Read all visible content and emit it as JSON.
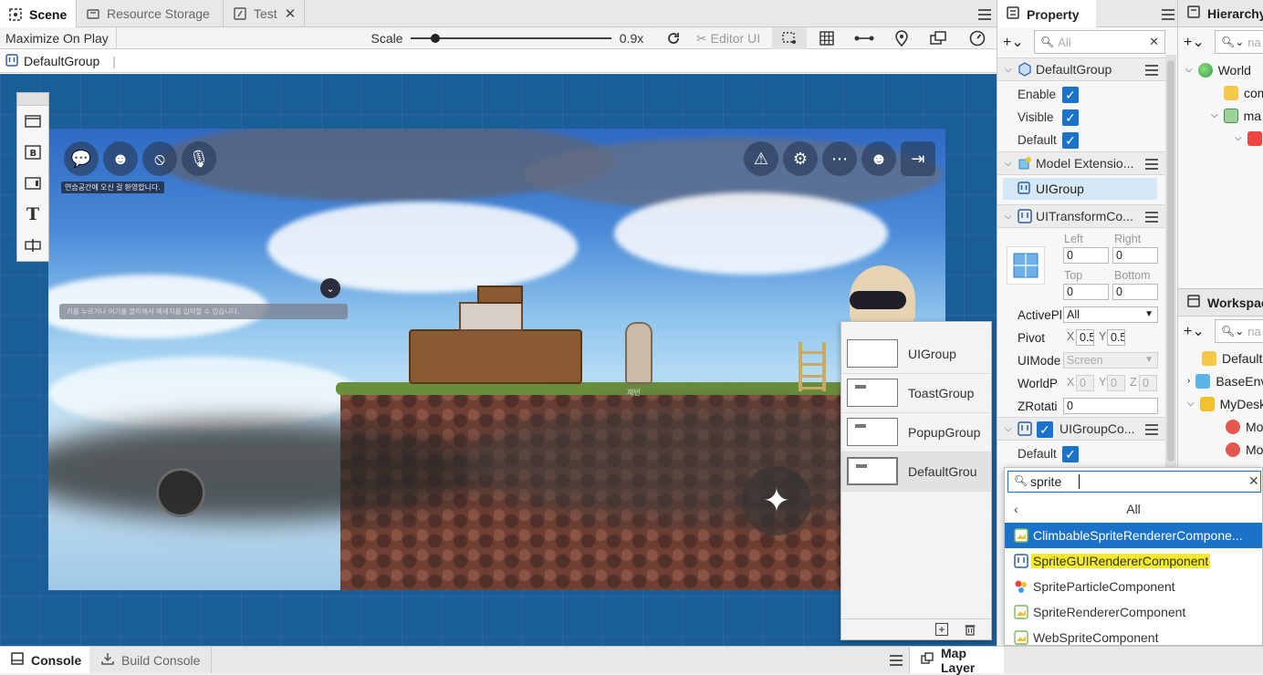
{
  "tabs": [
    {
      "label": "Scene",
      "icon": "scene-icon",
      "active": true
    },
    {
      "label": "Resource Storage",
      "icon": "storage-icon",
      "active": false
    },
    {
      "label": "Test",
      "icon": "test-icon",
      "active": false
    }
  ],
  "toolbar": {
    "maximize_label": "Maximize On Play",
    "scale_label": "Scale",
    "scale_value": "0.9x",
    "scale_fraction": 0.1,
    "editor_ui_label": "Editor UI"
  },
  "breadcrumb": {
    "label": "DefaultGroup"
  },
  "game_hud": {
    "welcome_text": "연습공간에 오신 걸 환영합니다.",
    "chat_placeholder": "키를 누르거나 여기를 클릭해서 메세지를 입력할 수 있습니다.",
    "npc_label": "재빈"
  },
  "group_popup": {
    "items": [
      {
        "label": "UIGroup",
        "selected": false
      },
      {
        "label": "ToastGroup",
        "selected": false
      },
      {
        "label": "PopupGroup",
        "selected": false
      },
      {
        "label": "DefaultGrou",
        "selected": true
      }
    ]
  },
  "property": {
    "tab_label": "Property",
    "search_placeholder": "All",
    "entity_name": "DefaultGroup",
    "enable_label": "Enable",
    "visible_label": "Visible",
    "default_label": "Default",
    "model_section": "Model Extensio...",
    "model_item": "UIGroup",
    "transform_section": "UITransformCo...",
    "left_label": "Left",
    "left_value": "0",
    "right_label": "Right",
    "right_value": "0",
    "top_label": "Top",
    "top_value": "0",
    "bottom_label": "Bottom",
    "bottom_value": "0",
    "activepl_label": "ActivePl",
    "activepl_value": "All",
    "pivot_label": "Pivot",
    "pivot_x_label": "X",
    "pivot_x": "0.5",
    "pivot_y_label": "Y",
    "pivot_y": "0.5",
    "uimode_label": "UIMode",
    "uimode_value": "Screen",
    "worldp_label": "WorldP",
    "worldp_x": "0",
    "worldp_y": "0",
    "worldp_z": "0",
    "worldp_z_label": "Z",
    "zrot_label": "ZRotati",
    "zrot_value": "0",
    "uigroup_section": "UIGroupCo...",
    "uigroup_default_label": "Default"
  },
  "component_search": {
    "query": "sprite",
    "category": "All",
    "results": [
      {
        "label": "ClimbableSpriteRendererCompone...",
        "highlighted": true,
        "icon": "sprite-component-icon"
      },
      {
        "label": "SpriteGUIRendererComponent",
        "highlighted": false,
        "marked": true,
        "icon": "ui-component-icon"
      },
      {
        "label": "SpriteParticleComponent",
        "highlighted": false,
        "icon": "particle-component-icon"
      },
      {
        "label": "SpriteRendererComponent",
        "highlighted": false,
        "icon": "sprite-component-icon"
      },
      {
        "label": "WebSpriteComponent",
        "highlighted": false,
        "icon": "sprite-component-icon"
      }
    ]
  },
  "hierarchy": {
    "tab_label": "Hierarchy",
    "search_placeholder": "na",
    "items": [
      {
        "label": "World"
      },
      {
        "label": "com"
      },
      {
        "label": "ma"
      },
      {
        "label": ""
      }
    ]
  },
  "workspace": {
    "tab_label": "Workspac",
    "search_placeholder": "na",
    "items": [
      {
        "label": "Default"
      },
      {
        "label": "BaseEnv"
      },
      {
        "label": "MyDesk"
      },
      {
        "label": "Mo"
      },
      {
        "label": "Mo"
      }
    ]
  },
  "bottom": {
    "console_label": "Console",
    "build_console_label": "Build Console",
    "map_layer_label": "Map Layer"
  },
  "colors": {
    "accent": "#1a72c9",
    "viewport_bg": "#1a5e98",
    "highlight_yellow": "#f2ea2a"
  }
}
